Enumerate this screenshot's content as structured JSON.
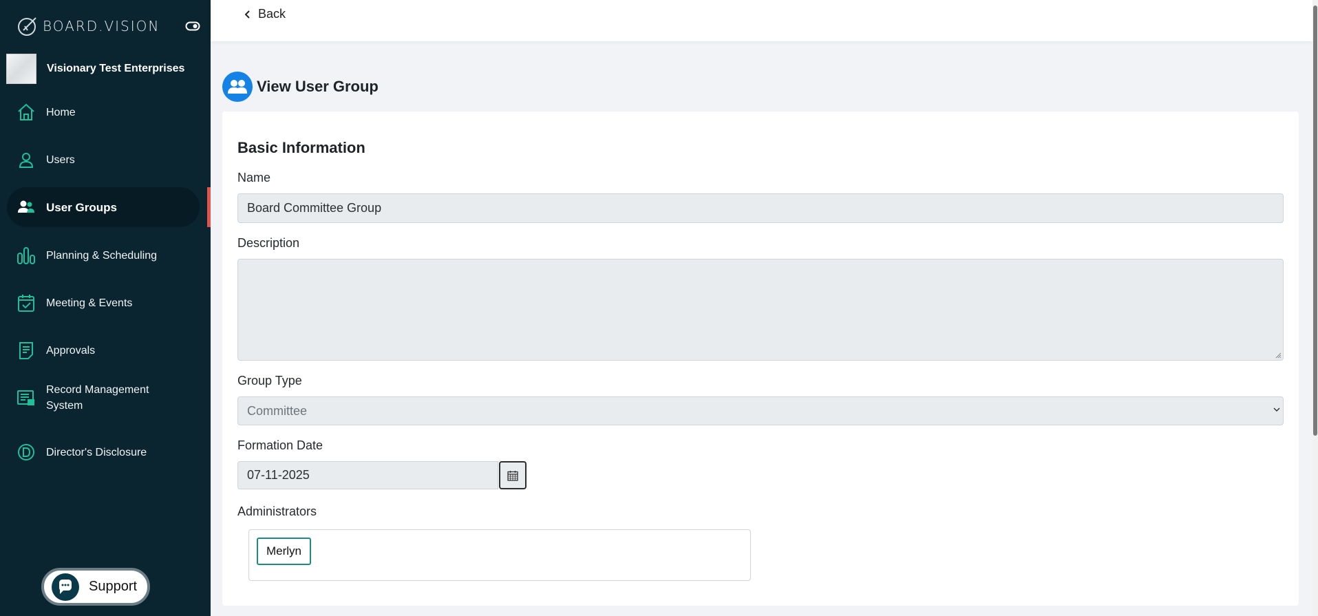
{
  "brand": {
    "name": "BOARD.VISION"
  },
  "org": {
    "name": "Visionary Test Enterprises"
  },
  "sidebar": {
    "items": [
      {
        "label": "Home",
        "icon": "home-icon"
      },
      {
        "label": "Users",
        "icon": "user-icon"
      },
      {
        "label": "User Groups",
        "icon": "user-group-icon",
        "active": true
      },
      {
        "label": "Planning & Scheduling",
        "icon": "bar-chart-icon"
      },
      {
        "label": "Meeting & Events",
        "icon": "calendar-check-icon"
      },
      {
        "label": "Approvals",
        "icon": "document-icon"
      },
      {
        "label": "Record Management System",
        "icon": "record-icon"
      },
      {
        "label": "Director's Disclosure",
        "icon": "d-circle-icon"
      }
    ],
    "support_label": "Support"
  },
  "topbar": {
    "back_label": "Back"
  },
  "page": {
    "title": "View User Group"
  },
  "form": {
    "section_title": "Basic Information",
    "name_label": "Name",
    "name_value": "Board Committee Group",
    "description_label": "Description",
    "description_value": "",
    "group_type_label": "Group Type",
    "group_type_value": "Committee",
    "formation_date_label": "Formation Date",
    "formation_date_value": "07-11-2025",
    "administrators_label": "Administrators",
    "administrators": [
      "Merlyn"
    ]
  },
  "colors": {
    "sidebar_bg": "#0a2430",
    "accent_teal": "#1fbf9a",
    "active_bar": "#e2534f",
    "page_icon": "#1582e6"
  }
}
